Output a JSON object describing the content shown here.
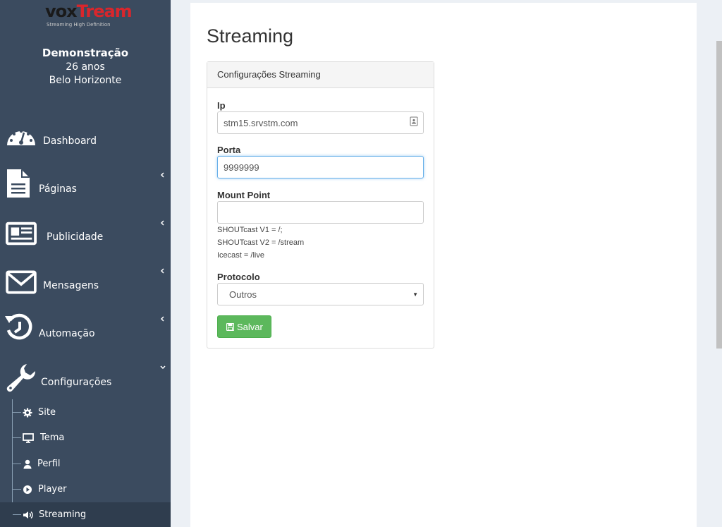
{
  "logo": {
    "part1": "vox",
    "part2": "Tream",
    "tagline": "Streaming High Definition"
  },
  "profile": {
    "name": "Demonstração",
    "age": "26 anos",
    "city": "Belo Horizonte"
  },
  "nav": [
    {
      "label": "Dashboard",
      "icon": "dashboard-gauge-icon"
    },
    {
      "label": "Páginas",
      "icon": "file-document-icon"
    },
    {
      "label": "Publicidade",
      "icon": "newspaper-icon"
    },
    {
      "label": "Mensagens",
      "icon": "envelope-icon"
    },
    {
      "label": "Automação",
      "icon": "history-icon"
    },
    {
      "label": "Configurações",
      "icon": "wrench-icon"
    }
  ],
  "subnav": [
    {
      "label": "Site",
      "icon": "gear-icon"
    },
    {
      "label": "Tema",
      "icon": "monitor-icon"
    },
    {
      "label": "Perfil",
      "icon": "user-icon"
    },
    {
      "label": "Player",
      "icon": "play-circle-icon"
    },
    {
      "label": "Streaming",
      "icon": "volume-icon"
    }
  ],
  "page": {
    "title": "Streaming"
  },
  "panel": {
    "heading": "Configurações Streaming",
    "ip": {
      "label": "Ip",
      "value": "stm15.srvstm.com"
    },
    "porta": {
      "label": "Porta",
      "value": "9999999"
    },
    "mount": {
      "label": "Mount Point",
      "value": "",
      "help": [
        "SHOUTcast V1 = /;",
        "SHOUTcast V2 = /stream",
        "Icecast = /live"
      ]
    },
    "protocolo": {
      "label": "Protocolo",
      "selected": "Outros"
    },
    "save_label": "Salvar"
  },
  "colors": {
    "sidebar": "#3b4b5f",
    "sidebar_active": "#2f3d4e",
    "save": "#5cb85c",
    "focus": "#66afe9"
  }
}
